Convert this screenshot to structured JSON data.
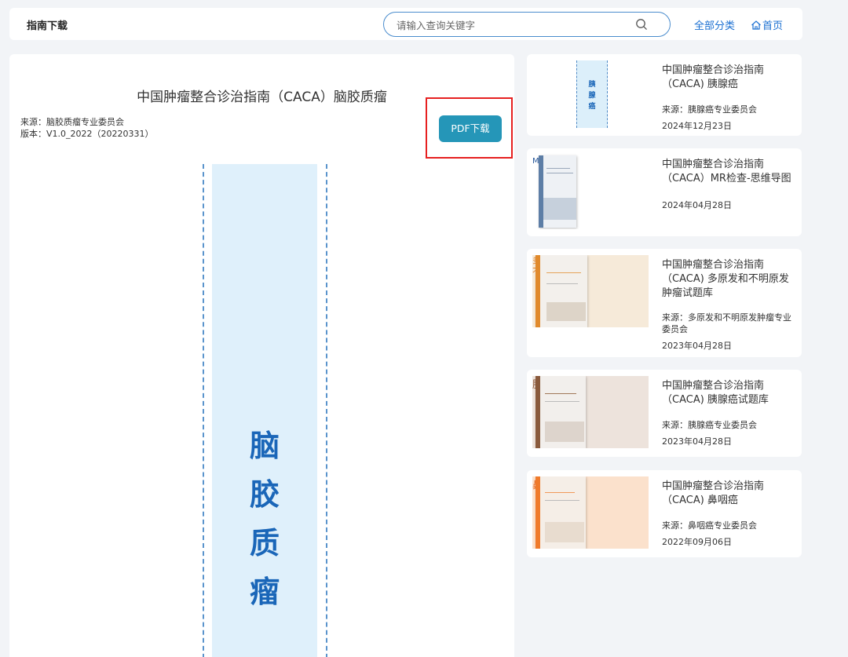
{
  "header": {
    "title": "指南下载",
    "search_placeholder": "请输入查询关键字",
    "all_categories": "全部分类",
    "home": "首页"
  },
  "document": {
    "title": "中国肿瘤整合诊治指南（CACA）脑胶质瘤",
    "source": "来源：脑胶质瘤专业委员会",
    "version": "版本：V1.0_2022（20220331）",
    "download_label": "PDF下载",
    "cover_text": "脑\n胶\n质\n瘤"
  },
  "related": [
    {
      "title": "中国肿瘤整合诊治指南（CACA) 胰腺癌",
      "source": "来源：胰腺癌专业委员会",
      "date": "2024年12月23日",
      "thumb_text": "胰\n腺\n癌"
    },
    {
      "title": "中国肿瘤整合诊治指南（CACA）MR检查-思维导图",
      "source": "",
      "date": "2024年04月28日",
      "thumb_text": "MR检查"
    },
    {
      "title": "中国肿瘤整合诊治指南（CACA) 多原发和不明原发肿瘤试题库",
      "source": "来源：多原发和不明原发肿瘤专业委员会",
      "date": "2023年04月28日",
      "thumb_text": "多原发和\n不明原发肿瘤"
    },
    {
      "title": "中国肿瘤整合诊治指南（CACA) 胰腺癌试题库",
      "source": "来源：胰腺癌专业委员会",
      "date": "2023年04月28日",
      "thumb_text": "胰腺癌"
    },
    {
      "title": "中国肿瘤整合诊治指南（CACA) 鼻咽癌",
      "source": "来源：鼻咽癌专业委员会",
      "date": "2022年09月06日",
      "thumb_text": "鼻咽癌"
    }
  ],
  "colors": {
    "accent": "#1a6fd1",
    "button": "#2596b8",
    "highlight": "#e62020",
    "cover_band": "#dff0fb",
    "cover_text": "#1a66b8"
  }
}
